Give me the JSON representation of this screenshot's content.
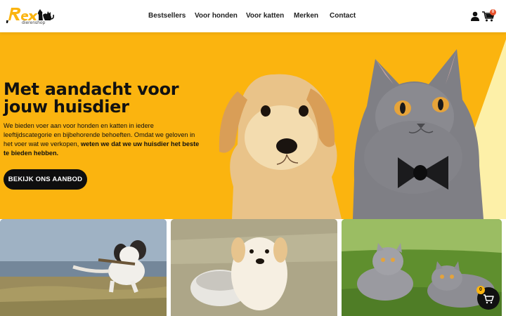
{
  "brand": {
    "name": "Rex",
    "tagline": "dierenshop",
    "accent": "#fbb40f"
  },
  "nav": {
    "items": [
      {
        "label": "Bestsellers"
      },
      {
        "label": "Voor honden"
      },
      {
        "label": "Voor katten"
      },
      {
        "label": "Merken"
      },
      {
        "label": "Contact"
      }
    ]
  },
  "header": {
    "account_icon": "user-icon",
    "cart_icon": "cart-icon",
    "cart_count": "0"
  },
  "hero": {
    "title": "Met aandacht voor jouw huisdier",
    "text_plain": "We bieden voer aan voor honden en katten in iedere leeftijdscategorie en bijbehorende behoeften. Omdat we geloven in het voer wat we verkopen, ",
    "text_bold": "weten we dat we uw huisdier het beste te bieden hebben.",
    "cta_label": "BEKIJK ONS AANBOD",
    "background_color": "#fbb40f"
  },
  "floating_cart": {
    "icon": "cart-icon",
    "count": "0"
  }
}
